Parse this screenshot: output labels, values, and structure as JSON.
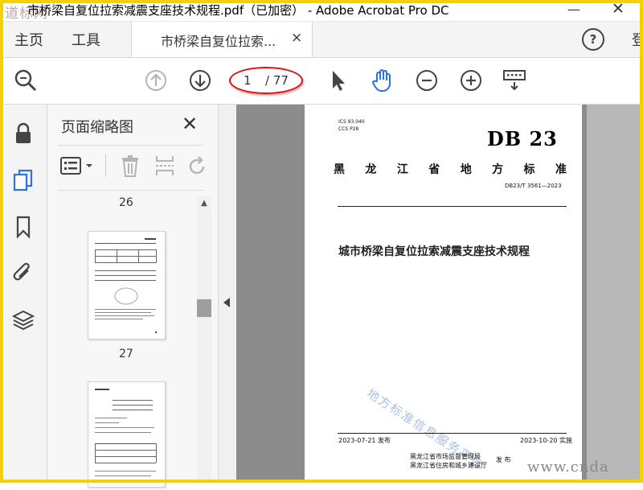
{
  "window": {
    "title": "市桥梁自复位拉索减震支座技术规程.pdf（已加密） - Adobe Acrobat Pro DC",
    "logo_text": "道标网",
    "minimize": "—",
    "close": "✕"
  },
  "tabs": {
    "home": "主页",
    "tools": "工具",
    "document": "市桥梁自复位拉索...",
    "document_close": "×",
    "help": "?",
    "login": "登"
  },
  "toolbar": {
    "page_current": "1",
    "page_total": "/ 77",
    "icons": [
      "zoom-search-icon",
      "previous-page-icon",
      "next-page-icon",
      "select-arrow-icon",
      "hand-tool-icon",
      "zoom-out-icon",
      "zoom-in-icon",
      "marquee-keyboard-icon"
    ],
    "highlight_color": "#dd1111",
    "accent_color": "#2c74d6"
  },
  "left_rail": {
    "icons": [
      "lock-icon",
      "pages-icon",
      "bookmark-icon",
      "attachment-icon",
      "layers-icon"
    ]
  },
  "thumbnail_panel": {
    "title": "页面缩略图",
    "close": "✕",
    "page_labels": [
      "26",
      "27"
    ]
  },
  "document": {
    "ics": "ICS  93.040",
    "ccs": "CCS  P28",
    "brand": "DB 23",
    "province": [
      "黑",
      "龙",
      "江",
      "省",
      "地",
      "方",
      "标",
      "准"
    ],
    "std_code": "DB23/T 3561—2023",
    "title": "城市桥梁自复位拉索减震支座技术规程",
    "watermark": "地方标准信息服务平台",
    "issue_date": "2023-07-21 发布",
    "impl_date": "2023-10-20 实施",
    "issuer_1": "黑龙江省市场监督管理局",
    "issuer_2": "黑龙江省住房和城乡建设厅",
    "issuer_verb": "发 布"
  },
  "site_watermark": "www.cnda"
}
